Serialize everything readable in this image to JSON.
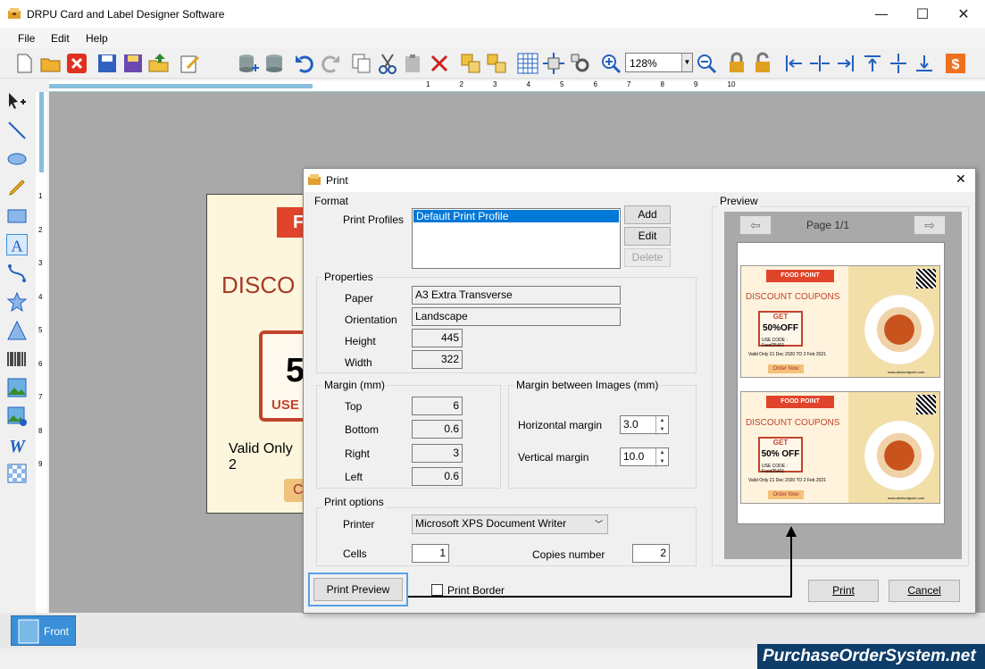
{
  "window": {
    "title": "DRPU Card and Label Designer Software",
    "minimize": "—",
    "maximize": "☐",
    "close": "✕"
  },
  "menu": [
    "File",
    "Edit",
    "Help"
  ],
  "toolbar": {
    "zoom_value": "128%"
  },
  "ruler": {
    "h_labels": [
      "1",
      "2",
      "3",
      "4",
      "5",
      "6",
      "7",
      "8",
      "9",
      "10"
    ],
    "v_labels": [
      "1",
      "2",
      "3",
      "4",
      "5",
      "6",
      "7",
      "8",
      "9"
    ]
  },
  "background_card": {
    "banner": "F",
    "heading": "DISCO",
    "amount": "5",
    "use": "USE",
    "valid": "Valid Only 2",
    "order": "C"
  },
  "bottom": {
    "front_tab": "Front",
    "watermark": "PurchaseOrderSystem.net"
  },
  "dialog": {
    "title": "Print",
    "close": "✕",
    "format": {
      "group": "Format",
      "profiles_label": "Print Profiles",
      "profiles": [
        "Default Print Profile"
      ],
      "add": "Add",
      "edit": "Edit",
      "delete": "Delete"
    },
    "properties": {
      "group": "Properties",
      "paper_label": "Paper",
      "paper": "A3 Extra Transverse",
      "orientation_label": "Orientation",
      "orientation": "Landscape",
      "height_label": "Height",
      "height": "445",
      "width_label": "Width",
      "width": "322"
    },
    "margin": {
      "group": "Margin (mm)",
      "top_label": "Top",
      "top": "6",
      "bottom_label": "Bottom",
      "bottom": "0.6",
      "right_label": "Right",
      "right": "3",
      "left_label": "Left",
      "left": "0.6"
    },
    "image_margin": {
      "group": "Margin between Images (mm)",
      "horizontal_label": "Horizontal margin",
      "horizontal": "3.0",
      "vertical_label": "Vertical margin",
      "vertical": "10.0"
    },
    "print_options": {
      "group": "Print options",
      "printer_label": "Printer",
      "printer": "Microsoft XPS Document Writer",
      "cells_label": "Cells",
      "cells": "1",
      "copies_label": "Copies number",
      "copies": "2"
    },
    "preview": {
      "group": "Preview",
      "page": "Page 1/1",
      "prev": "⇦",
      "next": "⇨",
      "coupon": {
        "brand": "FOOD POINT",
        "heading": "DISCOUNT COUPONS",
        "get": "GET",
        "offer": "50%OFF",
        "offer2": "50% OFF",
        "use_code": "USE CODE : Food25401",
        "valid": "Valid Only 21 Dec 2020 TO 2 Feb 2021",
        "order": "Order Now",
        "url": "www.abcfoodpoint.com"
      }
    },
    "print_preview_button": "Print Preview",
    "print_border_label": "Print Border",
    "print_button": "Print",
    "cancel_button": "Cancel"
  },
  "colors": {
    "accent": "#3b8fe0",
    "brand_red": "#e0452b",
    "workspace": "#a9a9a9"
  }
}
